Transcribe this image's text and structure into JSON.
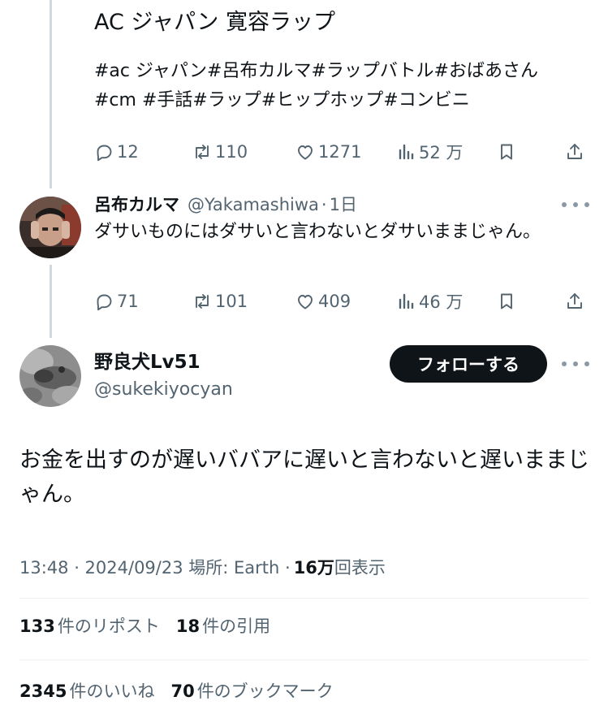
{
  "quoted": {
    "title": "AC ジャパン 寛容ラップ",
    "hashtags_line1": "#ac ジャパン#呂布カルマ#ラップバトル#おばあさん",
    "hashtags_line2": "#cm #手話#ラップ#ヒップホップ#コンビニ",
    "actions": {
      "replies": "12",
      "reposts": "110",
      "likes": "1271",
      "views": "52 万"
    }
  },
  "reply": {
    "name": "呂布カルマ",
    "handle": "@Yakamashiwa",
    "separator": "·",
    "time": "1日",
    "text": "ダサいものにはダサいと言わないとダサいままじゃん。",
    "actions": {
      "replies": "71",
      "reposts": "101",
      "likes": "409",
      "views": "46 万"
    }
  },
  "main": {
    "name": "野良犬Lv51",
    "handle": "@sukekiyocyan",
    "follow_label": "フォローする",
    "text": "お金を出すのが遅いババアに遅いと言わないと遅いままじゃん。",
    "timestamp": "13:48 · 2024/09/23 場所: Earth ·",
    "views_count": "16万",
    "views_label": "回表示"
  },
  "stats": {
    "reposts_count": "133",
    "reposts_label": "件のリポスト",
    "quotes_count": "18",
    "quotes_label": "件の引用",
    "likes_count": "2345",
    "likes_label": "件のいいね",
    "bookmarks_count": "70",
    "bookmarks_label": "件のブックマーク"
  },
  "colors": {
    "text": "#0f1419",
    "muted": "#536471",
    "thread_line": "#cfd9de",
    "divider": "#eff3f4",
    "follow_bg": "#0f1419"
  },
  "icons": [
    "reply-icon",
    "repost-icon",
    "like-icon",
    "views-icon",
    "bookmark-icon",
    "share-icon",
    "more-icon"
  ]
}
